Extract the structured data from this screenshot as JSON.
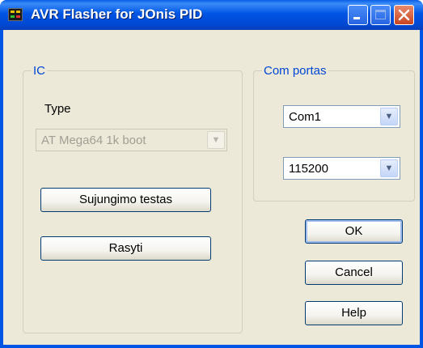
{
  "window": {
    "title": "AVR Flasher for JOnis PID",
    "controls": {
      "minimize_icon": "minimize-icon",
      "maximize_icon": "maximize-icon",
      "close_icon": "close-icon"
    }
  },
  "ic_group": {
    "legend": "IC",
    "type_label": "Type",
    "type_select": {
      "value": "AT Mega64 1k boot",
      "enabled": false
    },
    "test_button": "Sujungimo testas",
    "write_button": "Rasyti"
  },
  "com_group": {
    "legend": "Com portas",
    "port_select": {
      "value": "Com1"
    },
    "baud_select": {
      "value": "115200"
    }
  },
  "buttons": {
    "ok": "OK",
    "cancel": "Cancel",
    "help": "Help"
  },
  "colors": {
    "titlebar": "#0055e5",
    "dialog_bg": "#ece9d8",
    "group_legend": "#0046d5",
    "close_button": "#c94420"
  }
}
